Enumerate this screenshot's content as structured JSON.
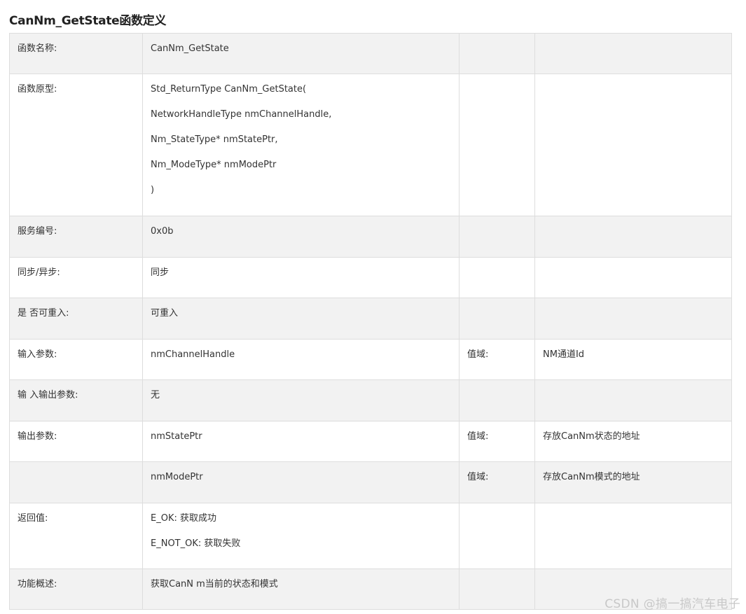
{
  "heading": "CanNm_GetState函数定义",
  "rows": [
    {
      "label": "函数名称:",
      "value": [
        "CanNm_GetState"
      ],
      "range_label": "",
      "range_value": ""
    },
    {
      "label": "函数原型:",
      "value": [
        "Std_ReturnType CanNm_GetState(",
        "NetworkHandleType nmChannelHandle,",
        "Nm_StateType* nmStatePtr,",
        "Nm_ModeType* nmModePtr",
        ")"
      ],
      "range_label": "",
      "range_value": ""
    },
    {
      "label": "服务编号:",
      "value": [
        "0x0b"
      ],
      "range_label": "",
      "range_value": ""
    },
    {
      "label": "同步/异步:",
      "value": [
        "同步"
      ],
      "range_label": "",
      "range_value": ""
    },
    {
      "label": "是 否可重入:",
      "value": [
        "可重入"
      ],
      "range_label": "",
      "range_value": ""
    },
    {
      "label": "输入参数:",
      "value": [
        "nmChannelHandle"
      ],
      "range_label": "值域:",
      "range_value": "NM通道Id"
    },
    {
      "label": "输 入输出参数:",
      "value": [
        "无"
      ],
      "range_label": "",
      "range_value": ""
    },
    {
      "label": "输出参数:",
      "value": [
        "nmStatePtr"
      ],
      "range_label": "值域:",
      "range_value": "存放CanNm状态的地址"
    },
    {
      "label": "",
      "value": [
        "nmModePtr"
      ],
      "range_label": "值域:",
      "range_value": "存放CanNm模式的地址"
    },
    {
      "label": "返回值:",
      "value": [
        "E_OK: 获取成功",
        "E_NOT_OK: 获取失败"
      ],
      "range_label": "",
      "range_value": ""
    },
    {
      "label": "功能概述:",
      "value": [
        "获取CanN m当前的状态和模式"
      ],
      "range_label": "",
      "range_value": ""
    }
  ],
  "watermark": "CSDN @搞一搞汽车电子"
}
